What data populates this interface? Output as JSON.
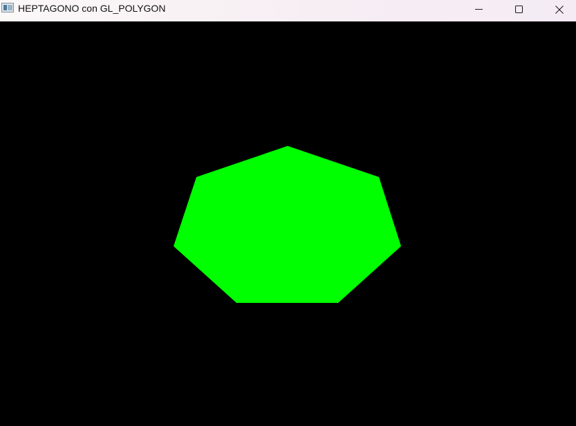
{
  "window": {
    "title": "HEPTAGONO con GL_POLYGON",
    "icon": "app-window-icon",
    "controls": {
      "minimize_icon": "minimize-icon",
      "maximize_icon": "maximize-icon",
      "close_icon": "close-icon"
    }
  },
  "scene": {
    "background_color": "#000000",
    "shape": "heptagon",
    "fill_color": "#00ff00"
  }
}
